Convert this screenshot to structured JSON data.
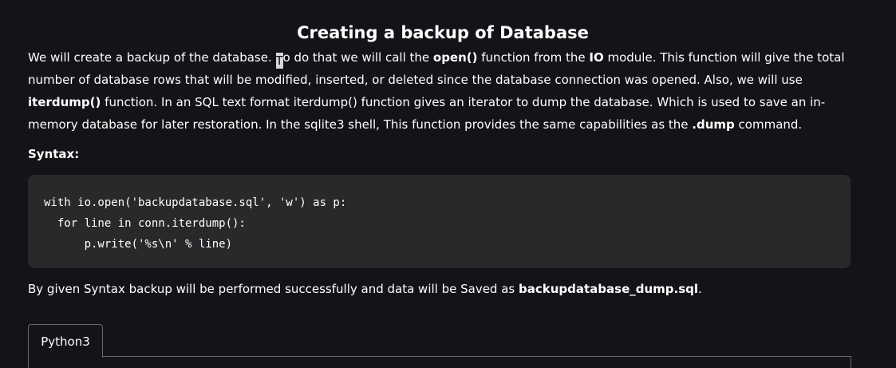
{
  "article": {
    "title": "Creating a backup of Database",
    "intro": {
      "p1_part1": "We will create a backup of the database. ",
      "cursor_char": "T",
      "p1_part2": "o do that we will call the ",
      "open_fn": "open()",
      "p1_part3": " function from the ",
      "io_module": "IO",
      "p1_part4": " module. This function will give the total number of database rows that will be modified, inserted, or deleted since the database connection was opened. Also, we will use ",
      "iterdump_fn": "iterdump()",
      "p1_part5": " function. In an SQL text format iterdump() function gives an iterator to dump the database. Which is used to save an in-memory database for later restoration. In the sqlite3 shell, This function provides the same capabilities as the ",
      "dump_cmd": ".dump",
      "p1_part6": " command."
    },
    "syntax_label": "Syntax:",
    "code_lines": [
      "with io.open('backupdatabase.sql', 'w') as p:",
      "  for line in conn.iterdump():",
      "      p.write('%s\\n' % line)"
    ],
    "after": {
      "part1": "By given Syntax backup will be performed successfully and data will be Saved as ",
      "filename": "backupdatabase_dump.sql",
      "part2": "."
    }
  },
  "code_tabs": {
    "active_tab": "Python3"
  }
}
